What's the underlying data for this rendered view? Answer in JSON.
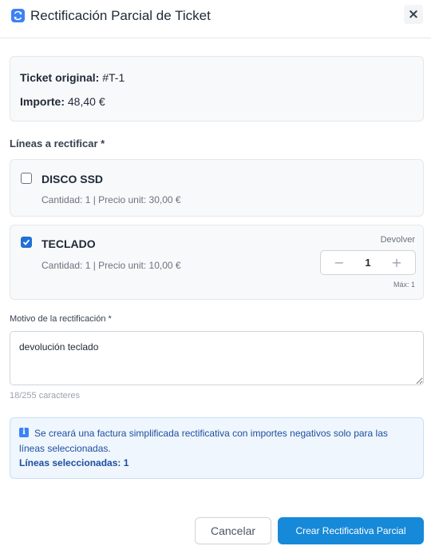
{
  "header": {
    "title": "Rectificación Parcial de Ticket",
    "icon": "refresh-icon",
    "close_label": "×"
  },
  "ticket": {
    "original_label": "Ticket original:",
    "original_value": "#T-1",
    "amount_label": "Importe:",
    "amount_value": "48,40 €"
  },
  "lines_section": {
    "label": "Líneas a rectificar *",
    "return_label": "Devolver",
    "items": [
      {
        "name": "DISCO SSD",
        "detail": "Cantidad: 1 | Precio unit: 30,00 €",
        "checked": false
      },
      {
        "name": "TECLADO",
        "detail": "Cantidad: 1 | Precio unit: 10,00 €",
        "checked": true,
        "quantity": "1",
        "minus": "−",
        "plus": "+",
        "max_label": "Máx: 1"
      }
    ]
  },
  "reason": {
    "label": "Motivo de la rectificación *",
    "value": "devolución teclado",
    "char_count": "18/255 caracteres"
  },
  "notice": {
    "icon_glyph": "i",
    "text": "Se creará una factura simplificada rectificativa con importes negativos solo para las líneas seleccionadas.",
    "selected_count": "Líneas seleccionadas: 1"
  },
  "footer": {
    "cancel_label": "Cancelar",
    "submit_label": "Crear Rectificativa Parcial"
  },
  "colors": {
    "accent": "#1689d8",
    "checkbox_checked": "#1e6fd9",
    "notice_text": "#1e4fa0",
    "notice_bg": "#eff6fd"
  }
}
